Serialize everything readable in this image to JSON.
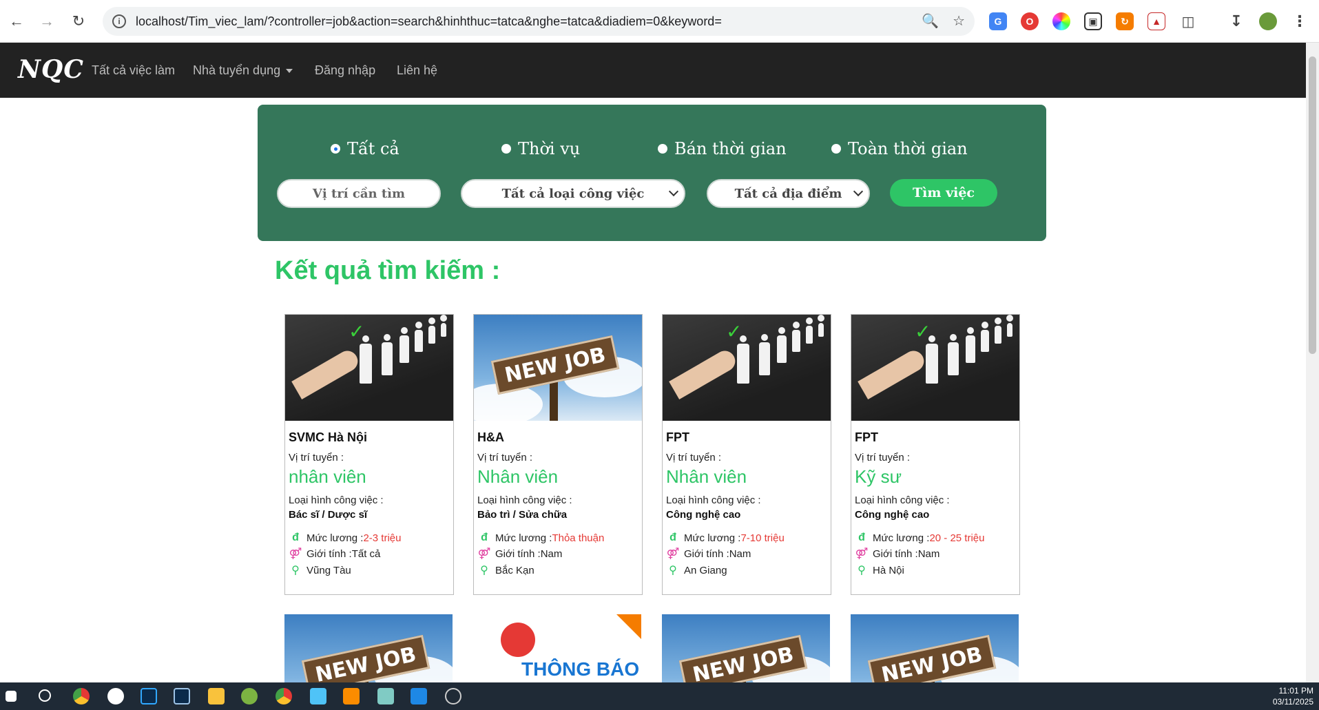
{
  "browser": {
    "url": "localhost/Tim_viec_lam/?controller=job&action=search&hinhthuc=tatca&nghe=tatca&diadiem=0&keyword="
  },
  "navbar": {
    "brand": "NQC",
    "links": [
      "Tất cả việc làm",
      "Nhà tuyển dụng",
      "Đăng nhập",
      "Liên hệ"
    ]
  },
  "search": {
    "radios": [
      "Tất cả",
      "Thời vụ",
      "Bán thời gian",
      "Toàn thời gian"
    ],
    "selected_radio": "Tất cả",
    "keyword_placeholder": "Vị trí cần tìm",
    "job_type": "Tất cả loại công việc",
    "location": "Tất cả địa điểm",
    "submit_label": "Tìm việc"
  },
  "results": {
    "title": "Kết quả tìm kiếm :",
    "labels": {
      "position": "Vị trí tuyển :",
      "type": "Loại hình công việc :",
      "salary": "Mức lương : ",
      "gender": "Giới tính : "
    },
    "currency_symbol": "đ",
    "cards": [
      {
        "company": "SVMC Hà Nội",
        "position": "nhân viên",
        "type": "Bác sĩ / Dược sĩ",
        "salary": "2-3 triệu",
        "gender": "Tất cả",
        "location": "Vũng Tàu",
        "image": "selection"
      },
      {
        "company": "H&A",
        "position": "Nhân viên",
        "type": "Bảo trì / Sửa chữa",
        "salary": "Thỏa thuận",
        "gender": "Nam",
        "location": "Bắc Kạn",
        "image": "new-job"
      },
      {
        "company": "FPT",
        "position": "Nhân viên",
        "type": "Công nghệ cao",
        "salary": "7-10 triệu",
        "gender": "Nam",
        "location": "An Giang",
        "image": "selection"
      },
      {
        "company": "FPT",
        "position": "Kỹ sư",
        "type": "Công nghệ cao",
        "salary": "20 - 25 triệu",
        "gender": "Nam",
        "location": "Hà Nội",
        "image": "selection"
      }
    ],
    "second_row_images": [
      "new-job",
      "announcement",
      "new-job",
      "new-job"
    ]
  },
  "image_texts": {
    "new_job": "NEW JOB",
    "announcement": "THÔNG BÁO"
  },
  "taskbar": {
    "time": "11:01 PM",
    "date": "03/11/2025"
  }
}
